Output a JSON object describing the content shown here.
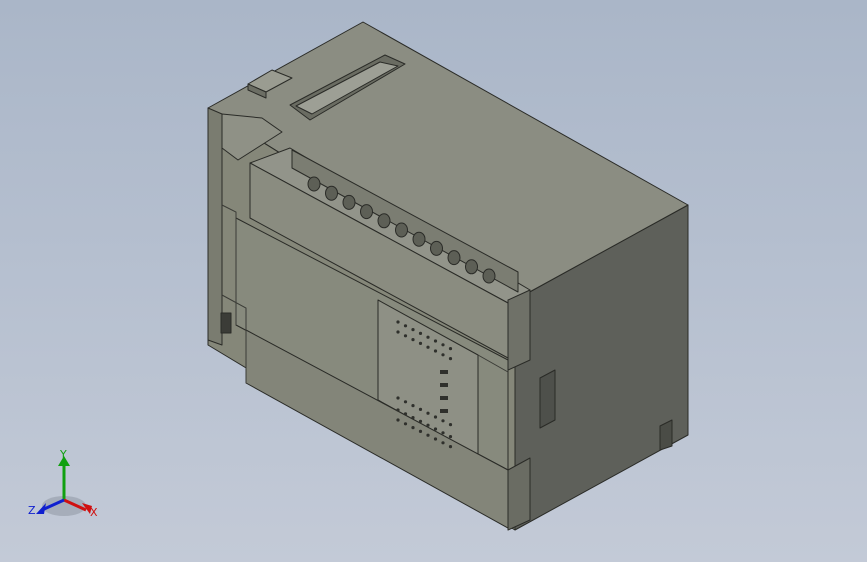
{
  "viewport": {
    "background_top": "#aab6c8",
    "background_bottom": "#c3cad7"
  },
  "model": {
    "body_color": "#878a7e",
    "top_color": "#8c8e83",
    "side_color": "#5e605a",
    "edge_color": "#2a2b27"
  },
  "triad": {
    "x_label": "X",
    "y_label": "Y",
    "z_label": "Z",
    "x_color": "#d01010",
    "y_color": "#10a010",
    "z_color": "#1020d0"
  }
}
